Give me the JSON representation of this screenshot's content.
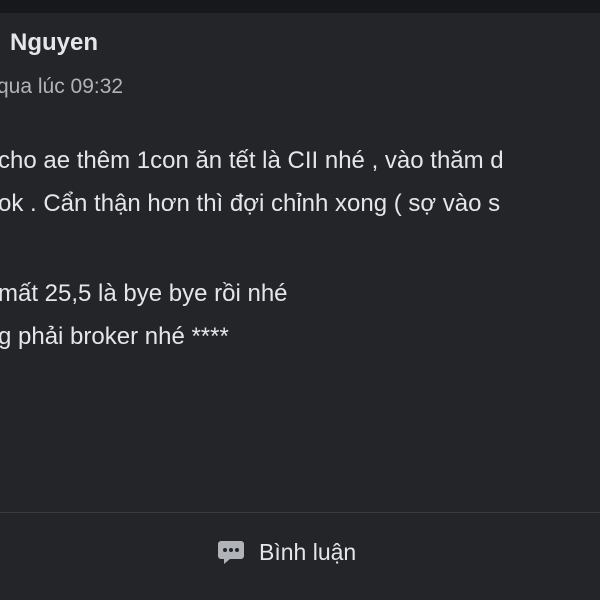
{
  "post": {
    "author": "Nguyen",
    "timestamp": "qua lúc 09:32",
    "lines": [
      "cho ae thêm 1con ăn tết là CII nhé , vào thăm d",
      "ok . Cẩn thận hơn thì đợi chỉnh xong ( sợ vào s",
      "mất 25,5 là bye bye rồi nhé",
      "g phải broker nhé ****"
    ]
  },
  "actions": {
    "comment_label": "Bình luận",
    "comment_icon": "comment-bubble-icon"
  },
  "colors": {
    "card_background": "#242528",
    "text_primary": "#e4e6eb",
    "text_secondary": "#b0b3b8",
    "icon": "#b0b3b8"
  }
}
